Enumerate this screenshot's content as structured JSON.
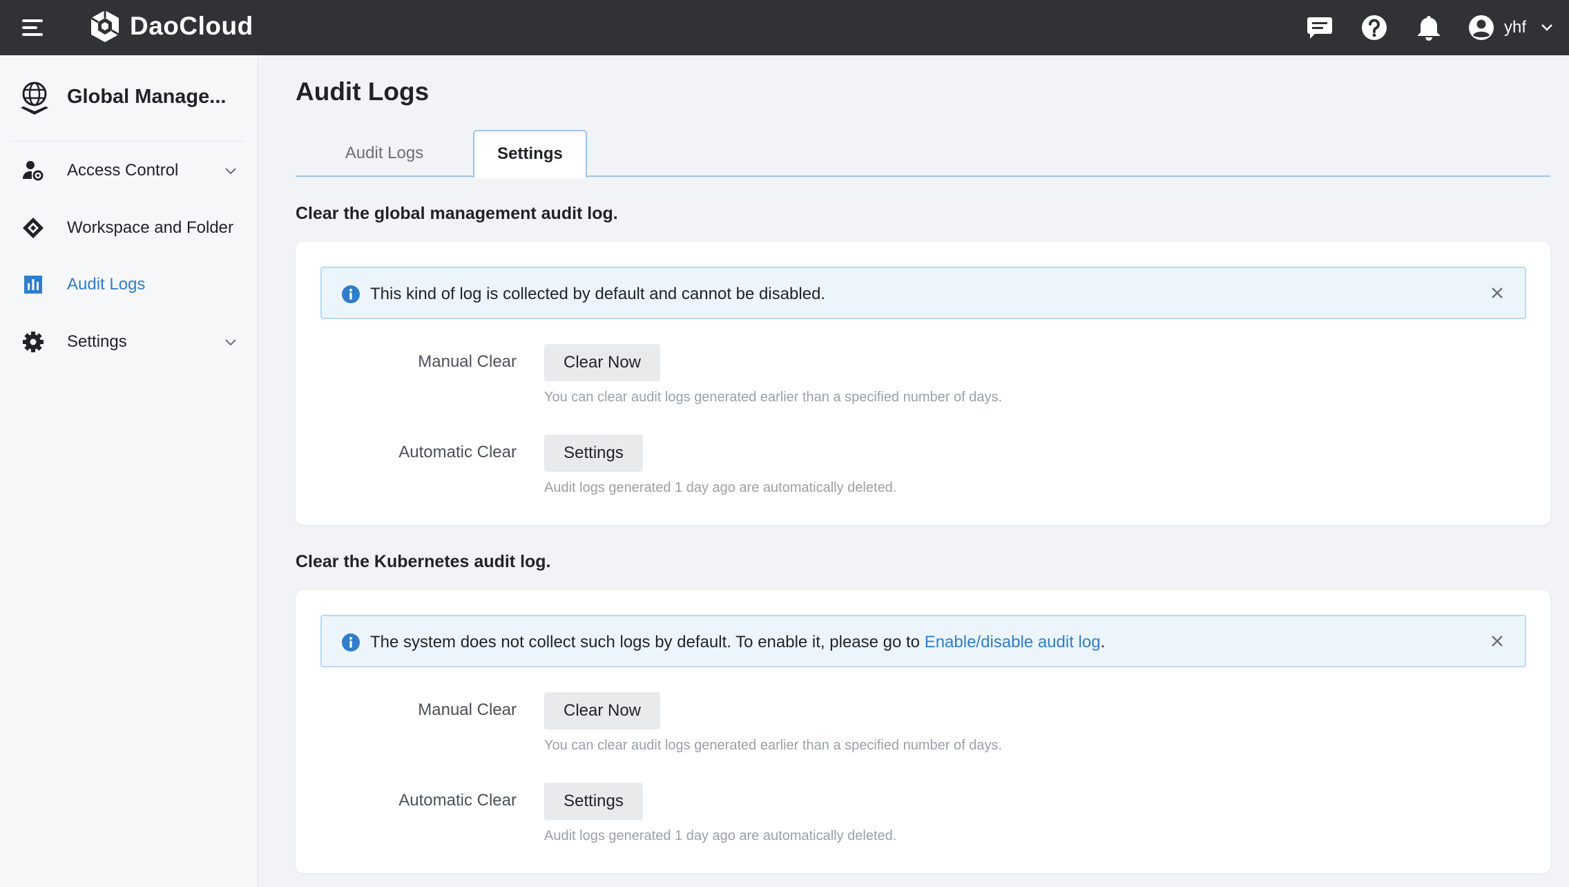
{
  "app": {
    "brand": "DaoCloud"
  },
  "topbar": {
    "icons": [
      "menu-icon",
      "message-icon",
      "help-icon",
      "bell-icon",
      "user-avatar-icon",
      "chevron-down-icon"
    ],
    "username": "yhf"
  },
  "sidebar": {
    "title": "Global Manage...",
    "items": [
      {
        "label": "Access Control",
        "icon": "access-control-icon",
        "expandable": true,
        "active": false
      },
      {
        "label": "Workspace and Folder",
        "icon": "workspace-icon",
        "expandable": false,
        "active": false
      },
      {
        "label": "Audit Logs",
        "icon": "audit-logs-icon",
        "expandable": false,
        "active": true
      },
      {
        "label": "Settings",
        "icon": "settings-gear-icon",
        "expandable": true,
        "active": false
      }
    ]
  },
  "main": {
    "title": "Audit Logs",
    "tabs": [
      {
        "label": "Audit Logs",
        "active": false
      },
      {
        "label": "Settings",
        "active": true
      }
    ],
    "sections": [
      {
        "title": "Clear the global management audit log.",
        "alert": {
          "text": "This kind of log is collected by default and cannot be disabled.",
          "link": "",
          "suffix": ""
        },
        "manual": {
          "label": "Manual Clear",
          "button": "Clear Now",
          "help": "You can clear audit logs generated earlier than a specified number of days."
        },
        "automatic": {
          "label": "Automatic Clear",
          "button": "Settings",
          "help": "Audit logs generated 1 day ago are automatically deleted."
        }
      },
      {
        "title": "Clear the Kubernetes audit log.",
        "alert": {
          "text": "The system does not collect such logs by default. To enable it, please go to ",
          "link": "Enable/disable audit log",
          "suffix": "."
        },
        "manual": {
          "label": "Manual Clear",
          "button": "Clear Now",
          "help": "You can clear audit logs generated earlier than a specified number of days."
        },
        "automatic": {
          "label": "Automatic Clear",
          "button": "Settings",
          "help": "Audit logs generated 1 day ago are automatically deleted."
        }
      }
    ]
  },
  "colors": {
    "topbar": "#303236",
    "accent": "#2f7dcb",
    "alert_bg": "#edf5fc",
    "alert_border": "#b7d8f3"
  }
}
